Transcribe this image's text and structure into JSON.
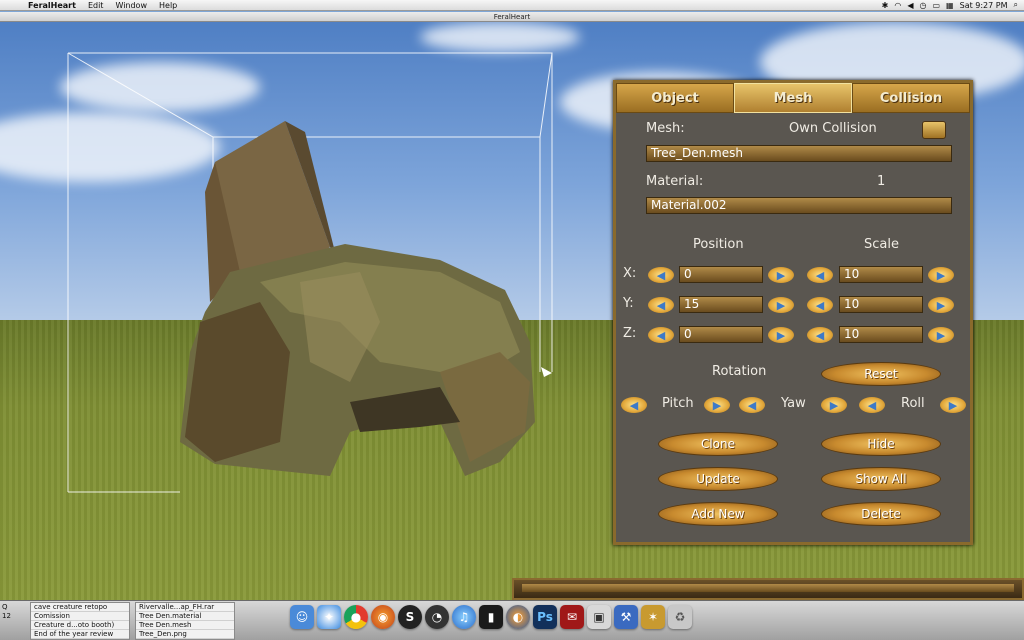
{
  "menubar": {
    "app_name": "FeralHeart",
    "items": [
      "Edit",
      "Window",
      "Help"
    ],
    "clock": "Sat 9:27 PM"
  },
  "window": {
    "title": "FeralHeart"
  },
  "panel": {
    "tabs": [
      {
        "label": "Object",
        "active": false
      },
      {
        "label": "Mesh",
        "active": true
      },
      {
        "label": "Collision",
        "active": false
      }
    ],
    "mesh_label": "Mesh:",
    "own_collision_label": "Own Collision",
    "mesh_value": "Tree_Den.mesh",
    "material_label": "Material:",
    "material_count": "1",
    "material_value": "Material.002",
    "position_label": "Position",
    "scale_label": "Scale",
    "axes": [
      {
        "axis": "X:",
        "position": "0",
        "scale": "10"
      },
      {
        "axis": "Y:",
        "position": "15",
        "scale": "10"
      },
      {
        "axis": "Z:",
        "position": "0",
        "scale": "10"
      }
    ],
    "rotation_label": "Rotation",
    "reset_label": "Reset",
    "pitch_label": "Pitch",
    "yaw_label": "Yaw",
    "roll_label": "Roll",
    "buttons": {
      "clone": "Clone",
      "hide": "Hide",
      "update": "Update",
      "show_all": "Show All",
      "add_new": "Add New",
      "delete": "Delete"
    }
  },
  "dock": {
    "stack_left_prefix": [
      "Q",
      "12",
      ""
    ],
    "stack_left": [
      "cave creature retopo",
      "Comission",
      "Creature d...oto booth)",
      "End of the year review"
    ],
    "stack_right": [
      "Rivervalle...ap_FH.rar",
      "Tree Den.material",
      "Tree Den.mesh",
      "Tree_Den.png"
    ],
    "app_icons": [
      "finder-icon",
      "safari-icon",
      "chrome-icon",
      "firefox-icon",
      "s-icon",
      "dashboard-icon",
      "itunes-icon",
      "terminal-icon",
      "blender-icon",
      "photoshop-icon",
      "mail-icon",
      "preview-icon",
      "xcode-icon",
      "feralheart-icon",
      "trash-icon"
    ],
    "photoshop_label": "Ps"
  }
}
